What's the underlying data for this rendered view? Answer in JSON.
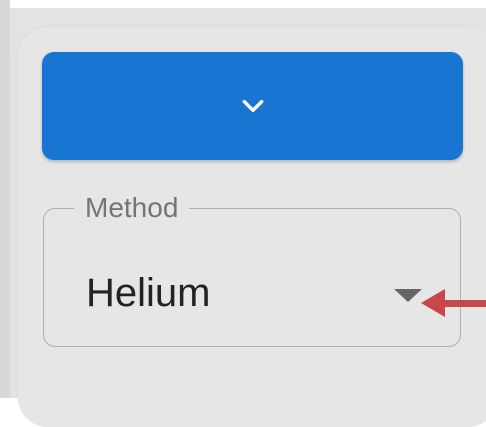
{
  "expand_button": {
    "icon": "chevron-down-icon",
    "color": "#1876d2"
  },
  "method_field": {
    "label": "Method",
    "value": "Helium",
    "dropdown_icon": "triangle-down-icon"
  },
  "annotation": {
    "icon": "arrow-left-icon",
    "color": "#c8474a"
  }
}
